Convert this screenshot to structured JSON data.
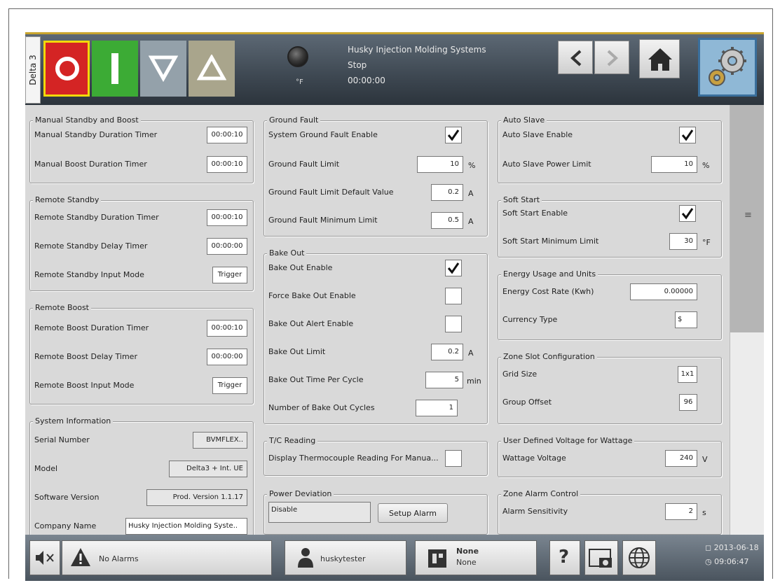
{
  "header": {
    "delta_label": "Delta 3",
    "system_name": "Husky Injection Molding Systems",
    "state": "Stop",
    "timer": "00:00:00",
    "temp_unit": "°F"
  },
  "sections": {
    "manual_standby": {
      "title": "Manual Standby and Boost",
      "rows": [
        {
          "label": "Manual Standby Duration Timer",
          "value": "00:00:10"
        },
        {
          "label": "Manual Boost Duration Timer",
          "value": "00:00:10"
        }
      ]
    },
    "remote_standby": {
      "title": "Remote Standby",
      "rows": [
        {
          "label": "Remote Standby Duration Timer",
          "value": "00:00:10"
        },
        {
          "label": "Remote Standby Delay Timer",
          "value": "00:00:00"
        },
        {
          "label": "Remote Standby Input Mode",
          "value": "Trigger"
        }
      ]
    },
    "remote_boost": {
      "title": "Remote Boost",
      "rows": [
        {
          "label": "Remote Boost Duration Timer",
          "value": "00:00:10"
        },
        {
          "label": "Remote Boost Delay Timer",
          "value": "00:00:00"
        },
        {
          "label": "Remote Boost Input Mode",
          "value": "Trigger"
        }
      ]
    },
    "system_info": {
      "title": "System Information",
      "rows": [
        {
          "label": "Serial Number",
          "value": "BVMFLEX.."
        },
        {
          "label": "Model",
          "value": "Delta3 + Int. UE"
        },
        {
          "label": "Software Version",
          "value": "Prod. Version 1.1.17"
        },
        {
          "label": "Company Name",
          "value": "Husky Injection Molding Syste.."
        }
      ]
    },
    "ground_fault": {
      "title": "Ground Fault",
      "rows": [
        {
          "label": "System Ground Fault Enable",
          "checked": true
        },
        {
          "label": "Ground Fault Limit",
          "value": "10",
          "unit": "%"
        },
        {
          "label": "Ground Fault Limit Default Value",
          "value": "0.2",
          "unit": "A"
        },
        {
          "label": "Ground Fault Minimum Limit",
          "value": "0.5",
          "unit": "A"
        }
      ]
    },
    "bake_out": {
      "title": "Bake Out",
      "rows": [
        {
          "label": "Bake Out Enable",
          "checked": true
        },
        {
          "label": "Force Bake Out Enable",
          "checked": false
        },
        {
          "label": "Bake Out Alert Enable",
          "checked": false
        },
        {
          "label": "Bake Out Limit",
          "value": "0.2",
          "unit": "A"
        },
        {
          "label": "Bake Out Time Per Cycle",
          "value": "5",
          "unit": "min"
        },
        {
          "label": "Number of Bake Out Cycles",
          "value": "1"
        }
      ]
    },
    "tc_reading": {
      "title": "T/C Reading",
      "rows": [
        {
          "label": "Display Thermocouple Reading For Manua...",
          "checked": false
        }
      ]
    },
    "power_deviation": {
      "title": "Power Deviation",
      "mode": "Disable",
      "button": "Setup Alarm"
    },
    "auto_slave": {
      "title": "Auto Slave",
      "rows": [
        {
          "label": "Auto Slave Enable",
          "checked": true
        },
        {
          "label": "Auto Slave Power Limit",
          "value": "10",
          "unit": "%"
        }
      ]
    },
    "soft_start": {
      "title": "Soft Start",
      "rows": [
        {
          "label": "Soft Start Enable",
          "checked": true
        },
        {
          "label": "Soft Start Minimum Limit",
          "value": "30",
          "unit": "°F"
        }
      ]
    },
    "energy": {
      "title": "Energy Usage and Units",
      "rows": [
        {
          "label": "Energy Cost Rate (Kwh)",
          "value": "0.00000"
        },
        {
          "label": "Currency Type",
          "value": "$"
        }
      ]
    },
    "zone_slot": {
      "title": "Zone Slot Configuration",
      "rows": [
        {
          "label": "Grid Size",
          "value": "1x1"
        },
        {
          "label": "Group Offset",
          "value": "96"
        }
      ]
    },
    "voltage": {
      "title": "User Defined Voltage for Wattage",
      "rows": [
        {
          "label": "Wattage Voltage",
          "value": "240",
          "unit": "V"
        }
      ]
    },
    "zone_alarm": {
      "title": "Zone Alarm Control",
      "rows": [
        {
          "label": "Alarm Sensitivity",
          "value": "2",
          "unit": "s"
        }
      ]
    }
  },
  "bottom": {
    "alarms": "No Alarms",
    "user": "huskytester",
    "mold_line1": "None",
    "mold_line2": "None",
    "help": "?",
    "date": "2013-06-18",
    "time": "09:06:47"
  }
}
